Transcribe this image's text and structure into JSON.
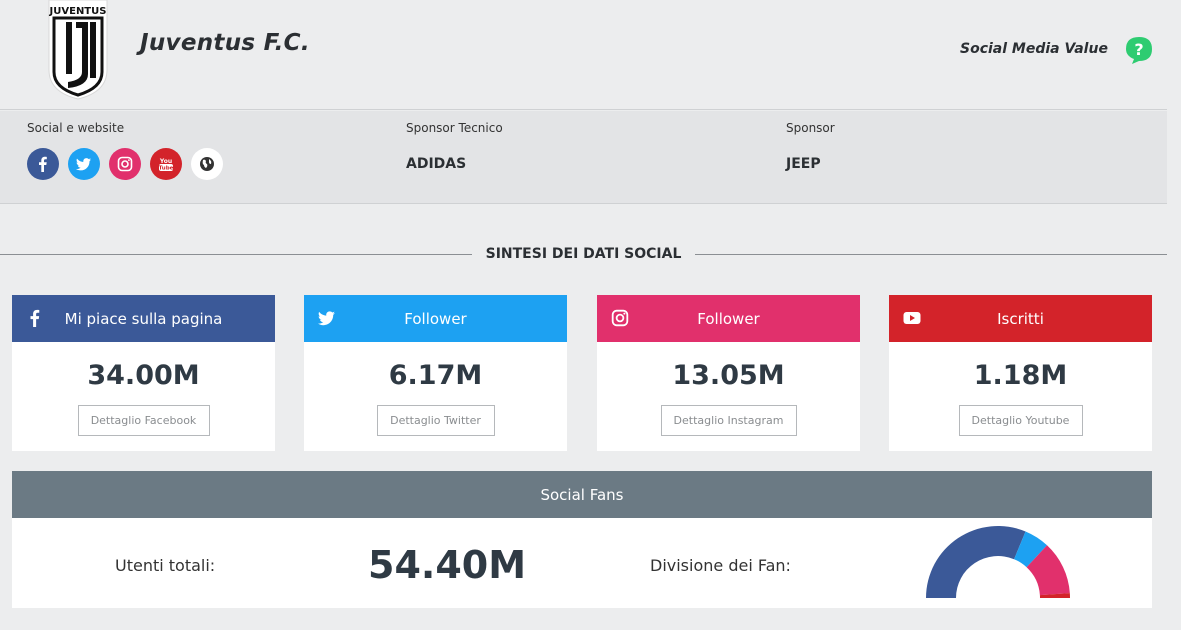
{
  "club": {
    "name": "Juventus F.C.",
    "logo_text": "JUVENTUS"
  },
  "header": {
    "smv_label": "Social Media Value",
    "help_icon": "question-bubble-icon"
  },
  "info": {
    "social_label": "Social e website",
    "social_icons": [
      {
        "name": "facebook-icon",
        "color": "#3b5998"
      },
      {
        "name": "twitter-icon",
        "color": "#1da1f2"
      },
      {
        "name": "instagram-icon",
        "color": "#e1306c"
      },
      {
        "name": "youtube-icon",
        "color": "#d3232a"
      },
      {
        "name": "globe-icon",
        "color": "#ffffff"
      }
    ],
    "tech_sponsor_label": "Sponsor Tecnico",
    "tech_sponsor_value": "ADIDAS",
    "sponsor_label": "Sponsor",
    "sponsor_value": "JEEP"
  },
  "section_title": "SINTESI DEI DATI SOCIAL",
  "cards": [
    {
      "title": "Mi piace sulla pagina",
      "value": "34.00M",
      "button": "Dettaglio Facebook",
      "color": "#3b5998",
      "icon": "facebook-icon"
    },
    {
      "title": "Follower",
      "value": "6.17M",
      "button": "Dettaglio Twitter",
      "color": "#1da1f2",
      "icon": "twitter-icon"
    },
    {
      "title": "Follower",
      "value": "13.05M",
      "button": "Dettaglio Instagram",
      "color": "#e1306c",
      "icon": "instagram-icon"
    },
    {
      "title": "Iscritti",
      "value": "1.18M",
      "button": "Dettaglio Youtube",
      "color": "#d3232a",
      "icon": "youtube-icon"
    }
  ],
  "fans": {
    "title": "Social Fans",
    "total_label": "Utenti totali:",
    "total_value": "54.40M",
    "division_label": "Divisione dei Fan:"
  },
  "chart_data": {
    "type": "pie",
    "categories": [
      "Facebook",
      "Twitter",
      "Instagram",
      "Youtube"
    ],
    "values": [
      34.0,
      6.17,
      13.05,
      1.18
    ],
    "colors": [
      "#3b5998",
      "#1da1f2",
      "#e1306c",
      "#d3232a"
    ],
    "title": ""
  }
}
